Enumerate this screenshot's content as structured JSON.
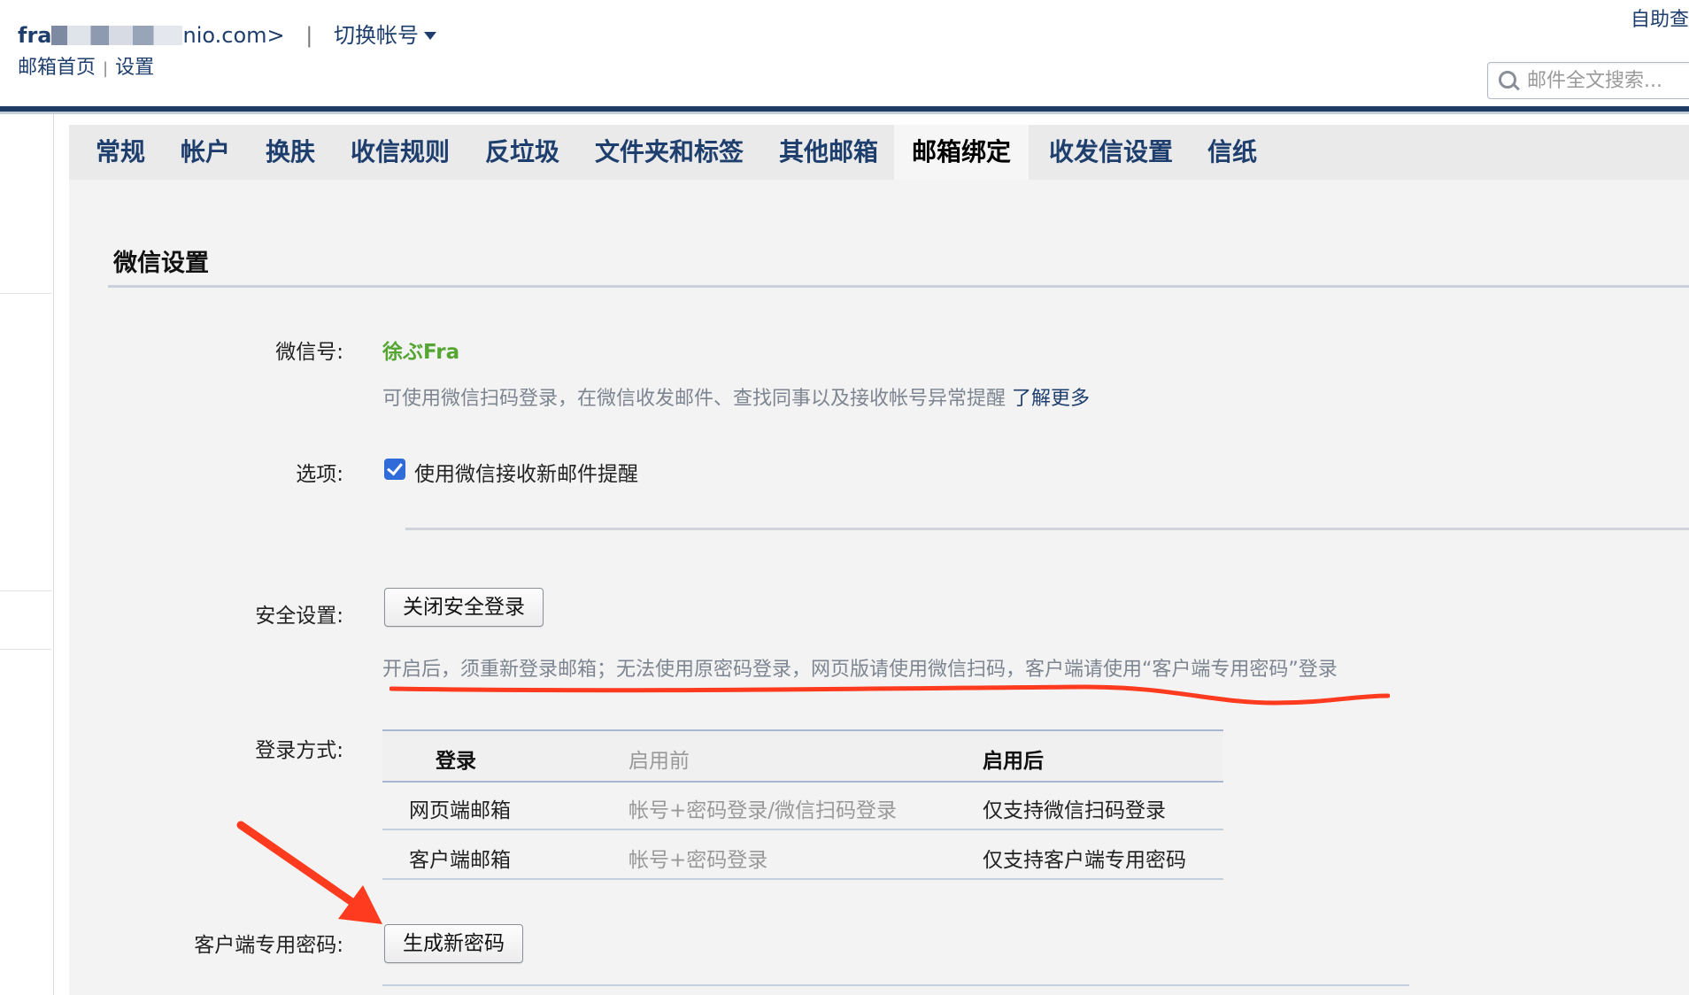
{
  "header": {
    "account_prefix": "fra",
    "account_suffix": "nio.com>",
    "separator": "|",
    "switch_account": "切换帐号",
    "nav_home": "邮箱首页",
    "nav_sep": "|",
    "nav_settings": "设置",
    "self_help": "自助查",
    "search_placeholder": "邮件全文搜索..."
  },
  "tabs": [
    {
      "label": "常规",
      "active": false
    },
    {
      "label": "帐户",
      "active": false
    },
    {
      "label": "换肤",
      "active": false
    },
    {
      "label": "收信规则",
      "active": false
    },
    {
      "label": "反垃圾",
      "active": false
    },
    {
      "label": "文件夹和标签",
      "active": false
    },
    {
      "label": "其他邮箱",
      "active": false
    },
    {
      "label": "邮箱绑定",
      "active": true
    },
    {
      "label": "收发信设置",
      "active": false
    },
    {
      "label": "信纸",
      "active": false
    }
  ],
  "wechat": {
    "section_title": "微信设置",
    "id_label": "微信号:",
    "id_value": "徐ぶFra",
    "id_hint": "可使用微信扫码登录，在微信收发邮件、查找同事以及接收帐号异常提醒",
    "learn_more": "了解更多",
    "option_label": "选项:",
    "option_checkbox": "使用微信接收新邮件提醒",
    "option_checked": true,
    "security_label": "安全设置:",
    "security_button": "关闭安全登录",
    "security_hint": "开启后，须重新登录邮箱；无法使用原密码登录，网页版请使用微信扫码，客户端请使用“客户端专用密码”登录",
    "login_label": "登录方式:",
    "login_table": {
      "headers": [
        "登录",
        "启用前",
        "启用后"
      ],
      "rows": [
        [
          "网页端邮箱",
          "帐号+密码登录/微信扫码登录",
          "仅支持微信扫码登录"
        ],
        [
          "客户端邮箱",
          "帐号+密码登录",
          "仅支持客户端专用密码"
        ]
      ]
    },
    "client_pw_label": "客户端专用密码:",
    "client_pw_button": "生成新密码"
  },
  "colors": {
    "link": "#1e3f6e",
    "wechat_green": "#55a532",
    "annotation_red": "#ff3b1f",
    "checkbox_blue": "#2f6bd9"
  }
}
